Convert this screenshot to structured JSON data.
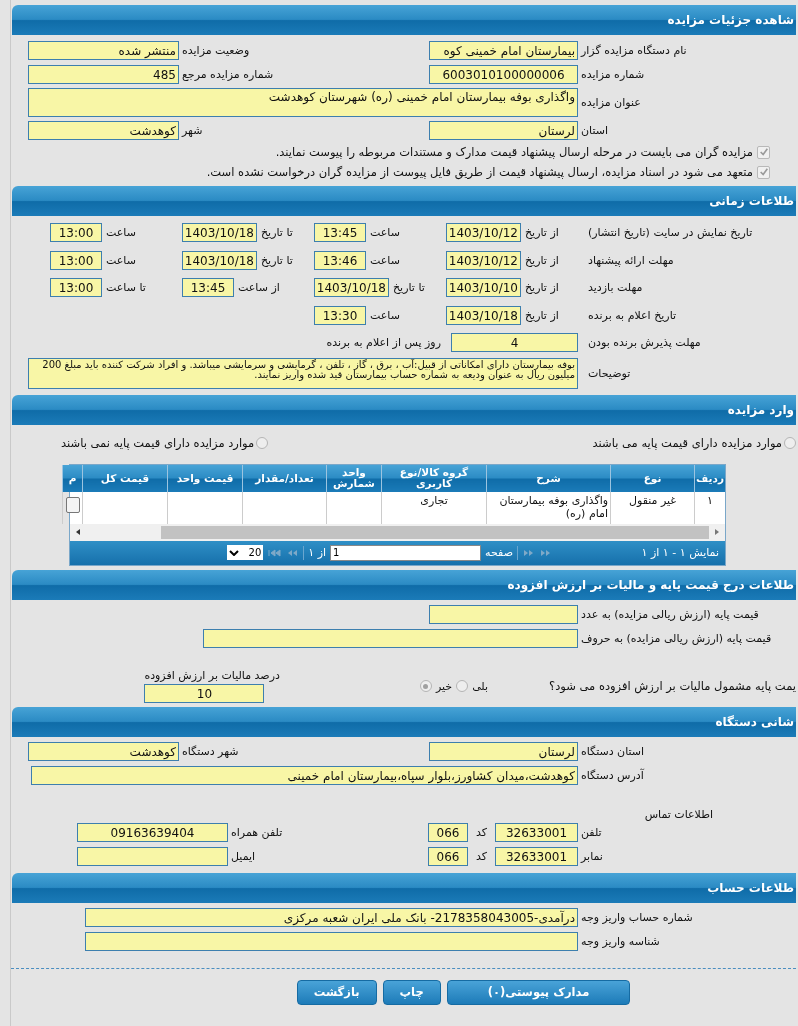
{
  "header": {
    "title": "شاهده جزئیات مزایده"
  },
  "details": {
    "organizer": {
      "label": "نام دستگاه مزایده گزار",
      "value": "بیمارستان امام خمینی کوه"
    },
    "status": {
      "label": "وضعیت مزایده",
      "value": "منتشر شده"
    },
    "auction_number": {
      "label": "شماره مزایده",
      "value": "6003010100000006"
    },
    "reference_number": {
      "label": "شماره مزایده مرجع",
      "value": "485"
    },
    "auction_title": {
      "label": "عنوان مزایده",
      "value": "واگذاری بوفه بیمارستان امام خمینی (ره) شهرستان کوهدشت"
    },
    "province": {
      "label": "استان",
      "value": "لرستان"
    },
    "city": {
      "label": "شهر",
      "value": "کوهدشت"
    },
    "checks": [
      {
        "label": "مزایده گران می بایست در مرحله ارسال پیشنهاد قیمت مدارک و مستندات مربوطه را پیوست نمایند.",
        "checked": true
      },
      {
        "label": "متعهد می شود در اسناد مزایده، ارسال پیشنهاد قیمت از طریق فایل پیوست از مزایده گران درخواست نشده است.",
        "checked": true
      }
    ]
  },
  "schedule": {
    "title": "طلاعات زمانی",
    "rows": [
      {
        "label": "تاریخ نمایش در سایت (تاریخ انتشار)",
        "pairs": [
          {
            "kind": "date",
            "label": "از تاریخ",
            "value": "1403/10/12"
          },
          {
            "kind": "time",
            "label": "ساعت",
            "value": "13:45"
          },
          {
            "kind": "date",
            "label": "تا تاریخ",
            "value": "1403/10/18"
          },
          {
            "kind": "time",
            "label": "ساعت",
            "value": "13:00"
          }
        ]
      },
      {
        "label": "مهلت ارائه پیشنهاد",
        "pairs": [
          {
            "kind": "date",
            "label": "از تاریخ",
            "value": "1403/10/12"
          },
          {
            "kind": "time",
            "label": "ساعت",
            "value": "13:46"
          },
          {
            "kind": "date",
            "label": "تا تاریخ",
            "value": "1403/10/18"
          },
          {
            "kind": "time",
            "label": "ساعت",
            "value": "13:00"
          }
        ]
      },
      {
        "label": "مهلت بازدید",
        "pairs": [
          {
            "kind": "date",
            "label": "از تاریخ",
            "value": "1403/10/10"
          },
          {
            "kind": "date",
            "label": "تا تاریخ",
            "value": "1403/10/18"
          },
          {
            "kind": "time",
            "label": "از ساعت",
            "value": "13:45"
          },
          {
            "kind": "time",
            "label": "تا ساعت",
            "value": "13:00"
          }
        ]
      },
      {
        "label": "تاریخ اعلام به برنده",
        "pairs": [
          {
            "kind": "date",
            "label": "از تاریخ",
            "value": "1403/10/18"
          },
          {
            "kind": "time",
            "label": "ساعت",
            "value": "13:30"
          }
        ]
      }
    ],
    "acceptance": {
      "label": "مهلت پذیرش برنده بودن",
      "value": "4",
      "suffix": "روز پس از اعلام به برنده"
    },
    "description": {
      "label": "توضیحات",
      "value": "بوفه بیمارستان دارای امکاناتی از قبیل:آب ، برق ، گاز ، تلفن ، گرمایشی و سرمایشی میباشد. و افراد شرکت کننده باید مبلغ 200 میلیون ریال به عنوان ودیعه به  شماره حساب بیمارستان قید شده واریز نمایند."
    }
  },
  "items": {
    "title": "وارد مزایده",
    "radios": [
      {
        "label": "موارد مزایده دارای قیمت پایه می باشند",
        "selected": false
      },
      {
        "label": "موارد مزایده دارای قیمت پایه نمی باشند",
        "selected": false
      }
    ],
    "table": {
      "columns": [
        "ردیف",
        "نوع",
        "شرح",
        "گروه کالا/نوع کاربری",
        "واحد شمارش",
        "تعداد/مقدار",
        "قیمت واحد",
        "قیمت کل",
        "م"
      ],
      "rows": [
        {
          "cells": [
            "۱",
            "غیر منقول",
            "واگذاری بوفه بیمارستان امام (ره)",
            "تجاری"
          ]
        }
      ]
    },
    "pager": {
      "summary": "نمایش ۱ - ۱ از ۱",
      "page_label": "صفحه",
      "page": "1",
      "of": "از ۱",
      "page_size": "20"
    }
  },
  "pricing": {
    "title": "طلاعات درج قیمت پایه و مالیات بر ارزش افزوده",
    "base_number": {
      "label": "قیمت پایه (ارزش ریالی مزایده) به عدد"
    },
    "base_words": {
      "label": "قیمت پایه (ارزش ریالی مزایده) به حروف"
    },
    "vat_question": "یمت پایه مشمول مالیات بر ارزش افزوده می شود؟",
    "options": [
      {
        "label": "بلی",
        "selected": false
      },
      {
        "label": "خیر",
        "selected": true
      }
    ],
    "vat_percent": {
      "label": "درصد مالیات بر ارزش افزوده",
      "value": "10"
    }
  },
  "organization": {
    "title": "شانی دستگاه",
    "province": {
      "label": "استان دستگاه",
      "value": "لرستان"
    },
    "city": {
      "label": "شهر دستگاه",
      "value": "کوهدشت"
    },
    "address": {
      "label": "آدرس دستگاه",
      "value": "کوهدشت،میدان کشاورز،بلوار سپاه،بیمارستان امام خمینی"
    },
    "contact_title": "اطلاعات تماس",
    "phone": {
      "label": "تلفن",
      "value": "32633001",
      "code_label": "کد",
      "code": "066"
    },
    "mobile": {
      "label": "تلفن همراه",
      "value": "09163639404"
    },
    "fax": {
      "label": "نمابر",
      "value": "32633001",
      "code_label": "کد",
      "code": "066"
    },
    "email": {
      "label": "ایمیل"
    }
  },
  "account": {
    "title": "طلاعات حساب",
    "account_number": {
      "label": "شماره حساب واریز وجه",
      "value": "درآمدی-2178358043005- بانک ملی ایران شعبه مرکزی"
    },
    "payment_id": {
      "label": "شناسه واریز وجه"
    }
  },
  "buttons": [
    "مدارک پیوستی(۰)",
    "چاپ",
    "بازگشت"
  ]
}
